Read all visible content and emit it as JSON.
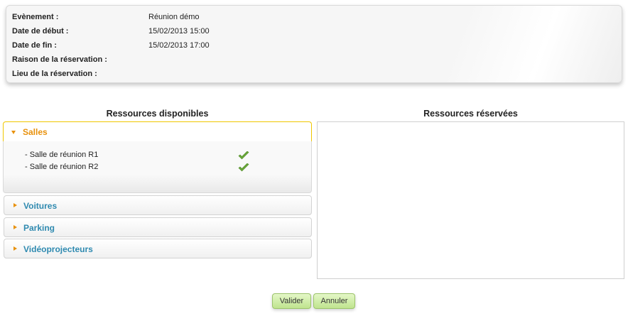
{
  "event": {
    "rows": [
      {
        "label": "Evènement :",
        "value": "Réunion démo"
      },
      {
        "label": "Date de début :",
        "value": "15/02/2013 15:00"
      },
      {
        "label": "Date de fin :",
        "value": "15/02/2013 17:00"
      },
      {
        "label": "Raison de la réservation :",
        "value": ""
      },
      {
        "label": "Lieu de la réservation :",
        "value": ""
      }
    ]
  },
  "available": {
    "title": "Ressources disponibles",
    "sections": [
      {
        "label": "Salles",
        "expanded": true,
        "items": [
          "- Salle de réunion R1",
          "- Salle de réunion R2"
        ]
      },
      {
        "label": "Voitures",
        "expanded": false
      },
      {
        "label": "Parking",
        "expanded": false
      },
      {
        "label": "Vidéoprojecteurs",
        "expanded": false
      }
    ]
  },
  "reserved": {
    "title": "Ressources réservées"
  },
  "buttons": {
    "validate": "Valider",
    "cancel": "Annuler"
  },
  "colors": {
    "accent_orange": "#e8910c",
    "link_blue": "#2f8ab0",
    "button_green": "#c8eb97",
    "check_green": "#6aa83a"
  }
}
